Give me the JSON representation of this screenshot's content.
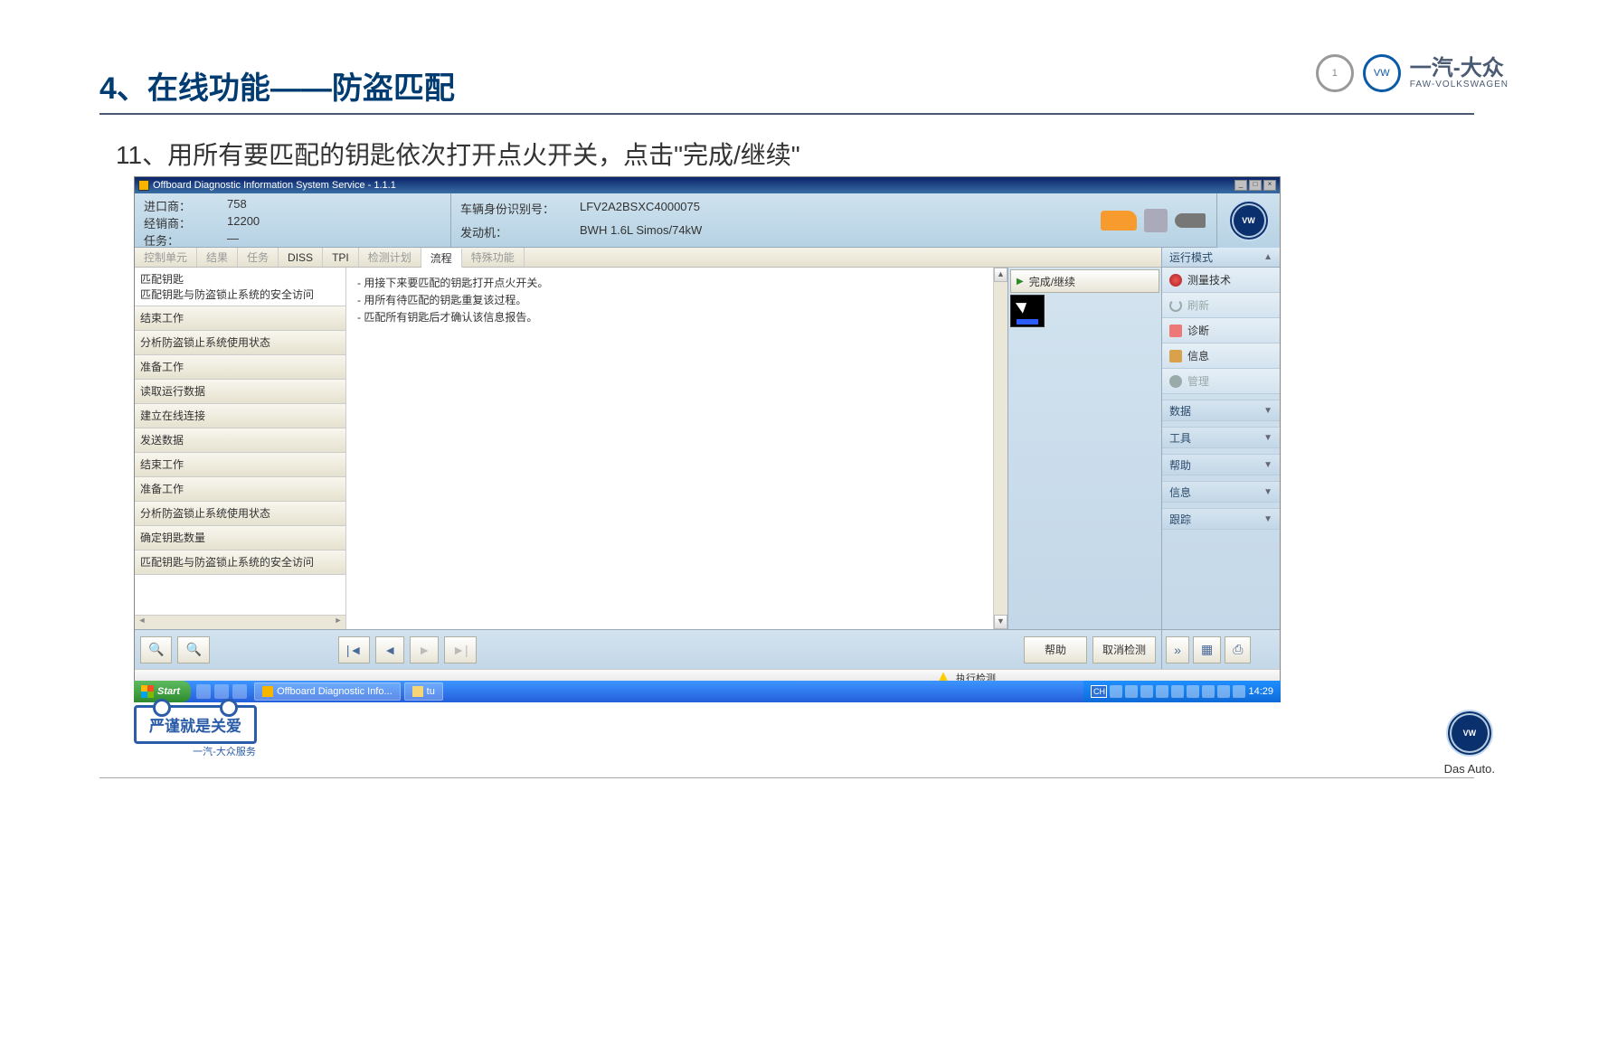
{
  "slide": {
    "title": "4、在线功能——防盗匹配",
    "instruction": "11、用所有要匹配的钥匙依次打开点火开关，点击\"完成/继续\"",
    "brand_cn": "一汽-大众",
    "brand_en": "FAW-VOLKSWAGEN",
    "motto": "严谨就是关爱",
    "motto_sub": "一汽-大众服务",
    "das_auto": "Das Auto."
  },
  "window": {
    "title": "Offboard Diagnostic Information System Service - 1.1.1",
    "info": {
      "importer_lbl": "进口商：",
      "importer_val": "758",
      "dealer_lbl": "经销商：",
      "dealer_val": "12200",
      "task_lbl": "任务：",
      "task_val": "—",
      "vin_lbl": "车辆身份识别号：",
      "vin_val": "LFV2A2BSXC4000075",
      "engine_lbl": "发动机：",
      "engine_val": "BWH 1.6L Simos/74kW"
    },
    "tabs": [
      "控制单元",
      "结果",
      "任务",
      "DISS",
      "TPI",
      "检测计划",
      "流程",
      "特殊功能"
    ],
    "active_tab": "流程",
    "steps_header": {
      "t1": "匹配钥匙",
      "t2": "匹配钥匙与防盗锁止系统的安全访问"
    },
    "steps": [
      "结束工作",
      "分析防盗锁止系统使用状态",
      "准备工作",
      "读取运行数据",
      "建立在线连接",
      "发送数据",
      "结束工作",
      "准备工作",
      "分析防盗锁止系统使用状态",
      "确定钥匙数量",
      "匹配钥匙与防盗锁止系统的安全访问"
    ],
    "message_lines": [
      "- 用接下来要匹配的钥匙打开点火开关。",
      "- 用所有待匹配的钥匙重复该过程。",
      "- 匹配所有钥匙后才确认该信息报告。"
    ],
    "action_done": "完成/继续",
    "footer": {
      "help": "帮助",
      "cancel": "取消检测"
    },
    "status_text": "执行检测",
    "side": {
      "mode_title": "运行模式",
      "items": [
        {
          "label": "测量技术",
          "icon": "gauge",
          "disabled": false
        },
        {
          "label": "刷新",
          "icon": "refresh",
          "disabled": true
        },
        {
          "label": "诊断",
          "icon": "diag",
          "disabled": false
        },
        {
          "label": "信息",
          "icon": "book",
          "disabled": false
        },
        {
          "label": "管理",
          "icon": "gear",
          "disabled": true
        }
      ],
      "groups": [
        "数据",
        "工具",
        "帮助",
        "信息",
        "跟踪"
      ]
    }
  },
  "taskbar": {
    "start": "Start",
    "app1": "Offboard Diagnostic Info...",
    "app2": "tu",
    "lang": "CH",
    "time": "14:29"
  }
}
